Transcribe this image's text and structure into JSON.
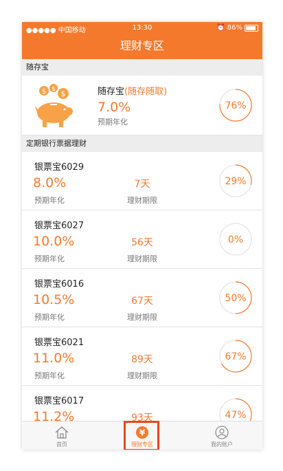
{
  "status_bar": {
    "carrier": "●●●●● 中国移动",
    "time": "13:30",
    "battery": "86%",
    "battery_level": 0.86
  },
  "nav": {
    "title": "理财专区"
  },
  "featured_section": {
    "header": "随存宝",
    "name": "随存宝",
    "tag": "(随存随取)",
    "rate": "7.0%",
    "rate_label": "预期年化",
    "progress_text": "76%",
    "progress": 0.76
  },
  "products_section": {
    "header": "定期银行票据理财",
    "items": [
      {
        "name": "银票宝6029",
        "rate": "8.0%",
        "rate_label": "预期年化",
        "term": "7天",
        "term_label": "理财期限",
        "progress_text": "29%",
        "progress": 0.29
      },
      {
        "name": "银票宝6027",
        "rate": "10.0%",
        "rate_label": "预期年化",
        "term": "56天",
        "term_label": "理财期限",
        "progress_text": "0%",
        "progress": 0.0
      },
      {
        "name": "银票宝6016",
        "rate": "10.5%",
        "rate_label": "预期年化",
        "term": "67天",
        "term_label": "理财期限",
        "progress_text": "50%",
        "progress": 0.5
      },
      {
        "name": "银票宝6021",
        "rate": "11.0%",
        "rate_label": "预期年化",
        "term": "89天",
        "term_label": "理财期限",
        "progress_text": "67%",
        "progress": 0.67
      },
      {
        "name": "银票宝6017",
        "rate": "11.2%",
        "rate_label": "预期年化",
        "term": "93天",
        "term_label": "理财期限",
        "progress_text": "47%",
        "progress": 0.47
      }
    ]
  },
  "tab_bar": {
    "home_label": "首页",
    "finance_label": "理财专区",
    "account_label": "我的账户"
  },
  "colors": {
    "accent": "#f5792d",
    "highlight": "#e8471c",
    "ring_track": "#e3e3e3",
    "section_bg": "#ededed"
  },
  "icons": {
    "home": "house-icon",
    "finance": "yen-coin-icon",
    "account": "user-circle-icon",
    "featured": "piggy-bank-icon"
  }
}
